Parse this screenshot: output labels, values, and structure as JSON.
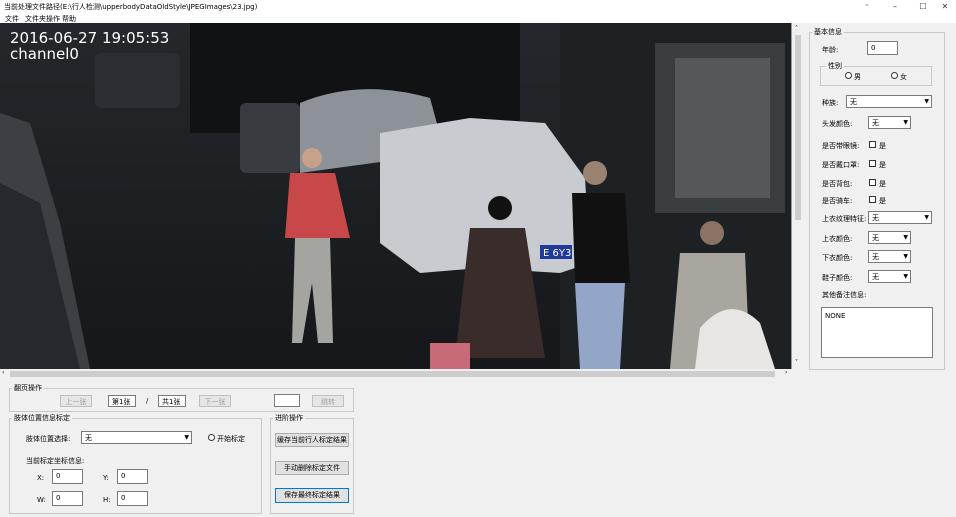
{
  "window": {
    "title": "当前处理文件路径(E:\\行人检测\\upperbodyDataOldStyle\\JPEGImages\\23.jpg)",
    "controls": [
      "⁼",
      "–",
      "☐",
      "✕"
    ]
  },
  "menu": [
    "文件",
    "文件夹操作",
    "帮助"
  ],
  "image": {
    "timestamp": "2016-06-27 19:05:53",
    "channel": "channel0",
    "plate": "E 6Y3"
  },
  "paging": {
    "title": "翻页操作",
    "prev": "上一张",
    "current": "第1张",
    "sep": "/",
    "total": "共1张",
    "next": "下一张",
    "jump_value": "",
    "jump": "跳转"
  },
  "body_mark": {
    "title": "肢体位置信息标定",
    "select_label": "肢体位置选择:",
    "select_value": "无",
    "start_label": "开始标定",
    "coord_title": "当前标定坐标信息:",
    "x_label": "X:",
    "x": "0",
    "y_label": "Y:",
    "y": "0",
    "w_label": "W:",
    "w": "0",
    "h_label": "H:",
    "h": "0"
  },
  "advanced": {
    "title": "进阶操作",
    "cache": "缓存当前行人标定结果",
    "delete": "手动删除标定文件",
    "save": "保存最终标定结果"
  },
  "basic": {
    "title": "基本信息",
    "age_label": "年龄:",
    "age": "0",
    "gender_label": "性别",
    "male": "男",
    "female": "女",
    "race_label": "种族:",
    "race": "无",
    "hair_label": "头发颜色:",
    "hair": "无",
    "glasses_label": "是否带眼镜:",
    "mask_label": "是否戴口罩:",
    "bag_label": "是否背包:",
    "bike_label": "是否骑车:",
    "yes": "是",
    "top_texture_label": "上衣纹理特征:",
    "top_texture": "无",
    "top_color_label": "上衣颜色:",
    "top_color": "无",
    "bottom_color_label": "下衣颜色:",
    "bottom_color": "无",
    "shoe_color_label": "鞋子颜色:",
    "shoe_color": "无",
    "notes_label": "其他备注信息:",
    "notes": "NONE"
  }
}
